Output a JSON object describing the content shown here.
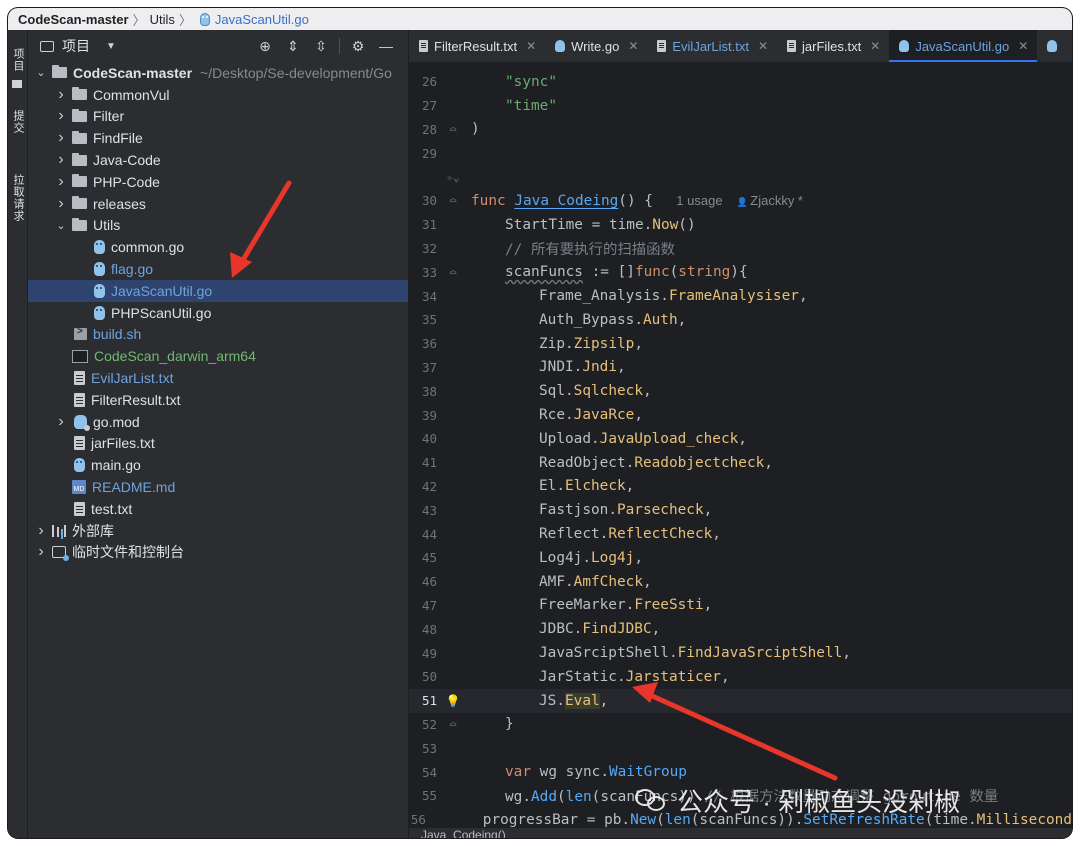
{
  "breadcrumb": {
    "project": "CodeScan-master",
    "folder": "Utils",
    "file": "JavaScanUtil.go"
  },
  "toolstrip": {
    "project_label": "项目",
    "commit_label": "提交",
    "pull_requests_label": "拉取请求"
  },
  "project_panel": {
    "title": "项目",
    "tree": [
      {
        "label": "CodeScan-master",
        "path_hint": "~/Desktop/Se-development/Go",
        "icon": "folder-icon",
        "arrow": "down",
        "indent": 0,
        "color": "normal",
        "root": true
      },
      {
        "label": "CommonVul",
        "icon": "folder-icon",
        "arrow": "right",
        "indent": 1,
        "color": "normal"
      },
      {
        "label": "Filter",
        "icon": "folder-icon",
        "arrow": "right",
        "indent": 1,
        "color": "normal"
      },
      {
        "label": "FindFile",
        "icon": "folder-icon",
        "arrow": "right",
        "indent": 1,
        "color": "normal"
      },
      {
        "label": "Java-Code",
        "icon": "folder-icon",
        "arrow": "right",
        "indent": 1,
        "color": "normal"
      },
      {
        "label": "PHP-Code",
        "icon": "folder-icon",
        "arrow": "right",
        "indent": 1,
        "color": "normal"
      },
      {
        "label": "releases",
        "icon": "folder-icon",
        "arrow": "right",
        "indent": 1,
        "color": "normal"
      },
      {
        "label": "Utils",
        "icon": "folder-icon",
        "arrow": "down",
        "indent": 1,
        "color": "normal"
      },
      {
        "label": "common.go",
        "icon": "go-file-icon",
        "arrow": "",
        "indent": 2,
        "color": "normal"
      },
      {
        "label": "flag.go",
        "icon": "go-file-icon",
        "arrow": "",
        "indent": 2,
        "color": "blue"
      },
      {
        "label": "JavaScanUtil.go",
        "icon": "go-file-icon",
        "arrow": "",
        "indent": 2,
        "color": "blue",
        "selected": true
      },
      {
        "label": "PHPScanUtil.go",
        "icon": "go-file-icon",
        "arrow": "",
        "indent": 2,
        "color": "normal"
      },
      {
        "label": "build.sh",
        "icon": "shell-script-icon",
        "arrow": "",
        "indent": 1,
        "color": "blue"
      },
      {
        "label": "CodeScan_darwin_arm64",
        "icon": "binary-file-icon",
        "arrow": "",
        "indent": 1,
        "color": "green"
      },
      {
        "label": "EvilJarList.txt",
        "icon": "text-file-icon",
        "arrow": "",
        "indent": 1,
        "color": "blue"
      },
      {
        "label": "FilterResult.txt",
        "icon": "text-file-icon",
        "arrow": "",
        "indent": 1,
        "color": "normal"
      },
      {
        "label": "go.mod",
        "icon": "go-mod-icon",
        "arrow": "right",
        "indent": 1,
        "color": "normal"
      },
      {
        "label": "jarFiles.txt",
        "icon": "text-file-icon",
        "arrow": "",
        "indent": 1,
        "color": "normal"
      },
      {
        "label": "main.go",
        "icon": "go-file-icon",
        "arrow": "",
        "indent": 1,
        "color": "normal"
      },
      {
        "label": "README.md",
        "icon": "markdown-file-icon",
        "arrow": "",
        "indent": 1,
        "color": "blue"
      },
      {
        "label": "test.txt",
        "icon": "text-file-icon",
        "arrow": "",
        "indent": 1,
        "color": "normal"
      },
      {
        "label": "外部库",
        "icon": "library-icon",
        "arrow": "right",
        "indent": 0,
        "color": "normal"
      },
      {
        "label": "临时文件和控制台",
        "icon": "scratches-icon",
        "arrow": "right",
        "indent": 0,
        "color": "normal"
      }
    ]
  },
  "tabs": [
    {
      "label": "FilterResult.txt",
      "icon": "text-file-icon",
      "active": false,
      "color": "normal"
    },
    {
      "label": "Write.go",
      "icon": "go-file-icon",
      "active": false,
      "color": "normal"
    },
    {
      "label": "EvilJarList.txt",
      "icon": "text-file-icon",
      "active": false,
      "color": "blue"
    },
    {
      "label": "jarFiles.txt",
      "icon": "text-file-icon",
      "active": false,
      "color": "normal"
    },
    {
      "label": "JavaScanUtil.go",
      "icon": "go-file-icon",
      "active": true,
      "color": "blue"
    }
  ],
  "editor": {
    "inlay_usage": "1 usage",
    "inlay_author": "Zjackky *",
    "lines": [
      {
        "n": "26",
        "indent": 1,
        "segs": [
          [
            "str",
            "\"sync\""
          ]
        ]
      },
      {
        "n": "27",
        "indent": 1,
        "segs": [
          [
            "str",
            "\"time\""
          ]
        ]
      },
      {
        "n": "28",
        "indent": 0,
        "segs": [
          [
            "plain",
            ")"
          ]
        ],
        "fold": true
      },
      {
        "n": "29",
        "indent": 0,
        "segs": []
      },
      {
        "n": "",
        "indent": 0,
        "segs": [],
        "ai_hint": true
      },
      {
        "n": "30",
        "indent": 0,
        "segs": [
          [
            "kw",
            "func "
          ],
          [
            "fn-ul",
            "Java_Codeing"
          ],
          [
            "plain",
            "() {  "
          ]
        ],
        "inlay": true,
        "fold": true
      },
      {
        "n": "31",
        "indent": 1,
        "segs": [
          [
            "plain",
            "StartTime = "
          ],
          [
            "plain",
            "time"
          ],
          [
            "plain",
            "."
          ],
          [
            "call",
            "Now"
          ],
          [
            "plain",
            "()"
          ]
        ]
      },
      {
        "n": "32",
        "indent": 1,
        "segs": [
          [
            "cmt",
            "// 所有要执行的扫描函数"
          ]
        ]
      },
      {
        "n": "33",
        "indent": 1,
        "segs": [
          [
            "plain-ul",
            "scanFuncs"
          ],
          [
            "plain",
            " := []"
          ],
          [
            "kw",
            "func"
          ],
          [
            "plain",
            "("
          ],
          [
            "kw",
            "string"
          ],
          [
            "plain",
            "){"
          ]
        ],
        "fold": true
      },
      {
        "n": "34",
        "indent": 2,
        "segs": [
          [
            "pkg",
            "Frame_Analysis"
          ],
          [
            "plain",
            "."
          ],
          [
            "mem",
            "FrameAnalysiser"
          ],
          [
            "plain",
            ","
          ]
        ]
      },
      {
        "n": "35",
        "indent": 2,
        "segs": [
          [
            "pkg",
            "Auth_Bypass"
          ],
          [
            "plain",
            "."
          ],
          [
            "mem",
            "Auth"
          ],
          [
            "plain",
            ","
          ]
        ]
      },
      {
        "n": "36",
        "indent": 2,
        "segs": [
          [
            "pkg",
            "Zip"
          ],
          [
            "plain",
            "."
          ],
          [
            "mem",
            "Zipsilp"
          ],
          [
            "plain",
            ","
          ]
        ]
      },
      {
        "n": "37",
        "indent": 2,
        "segs": [
          [
            "pkg",
            "JNDI"
          ],
          [
            "plain",
            "."
          ],
          [
            "mem",
            "Jndi"
          ],
          [
            "plain",
            ","
          ]
        ]
      },
      {
        "n": "38",
        "indent": 2,
        "segs": [
          [
            "pkg",
            "Sql"
          ],
          [
            "plain",
            "."
          ],
          [
            "mem",
            "Sqlcheck"
          ],
          [
            "plain",
            ","
          ]
        ]
      },
      {
        "n": "39",
        "indent": 2,
        "segs": [
          [
            "pkg",
            "Rce"
          ],
          [
            "plain",
            "."
          ],
          [
            "mem",
            "JavaRce"
          ],
          [
            "plain",
            ","
          ]
        ]
      },
      {
        "n": "40",
        "indent": 2,
        "segs": [
          [
            "pkg",
            "Upload"
          ],
          [
            "plain",
            "."
          ],
          [
            "mem",
            "JavaUpload_check"
          ],
          [
            "plain",
            ","
          ]
        ]
      },
      {
        "n": "41",
        "indent": 2,
        "segs": [
          [
            "pkg",
            "ReadObject"
          ],
          [
            "plain",
            "."
          ],
          [
            "mem",
            "Readobjectcheck"
          ],
          [
            "plain",
            ","
          ]
        ]
      },
      {
        "n": "42",
        "indent": 2,
        "segs": [
          [
            "pkg",
            "El"
          ],
          [
            "plain",
            "."
          ],
          [
            "mem",
            "Elcheck"
          ],
          [
            "plain",
            ","
          ]
        ]
      },
      {
        "n": "43",
        "indent": 2,
        "segs": [
          [
            "pkg",
            "Fastjson"
          ],
          [
            "plain",
            "."
          ],
          [
            "mem",
            "Parsecheck"
          ],
          [
            "plain",
            ","
          ]
        ]
      },
      {
        "n": "44",
        "indent": 2,
        "segs": [
          [
            "pkg",
            "Reflect"
          ],
          [
            "plain",
            "."
          ],
          [
            "mem",
            "ReflectCheck"
          ],
          [
            "plain",
            ","
          ]
        ]
      },
      {
        "n": "45",
        "indent": 2,
        "segs": [
          [
            "pkg",
            "Log4j"
          ],
          [
            "plain",
            "."
          ],
          [
            "mem",
            "Log4j"
          ],
          [
            "plain",
            ","
          ]
        ]
      },
      {
        "n": "46",
        "indent": 2,
        "segs": [
          [
            "pkg",
            "AMF"
          ],
          [
            "plain",
            "."
          ],
          [
            "mem",
            "AmfCheck"
          ],
          [
            "plain",
            ","
          ]
        ]
      },
      {
        "n": "47",
        "indent": 2,
        "segs": [
          [
            "pkg",
            "FreeMarker"
          ],
          [
            "plain",
            "."
          ],
          [
            "mem",
            "FreeSsti"
          ],
          [
            "plain",
            ","
          ]
        ]
      },
      {
        "n": "48",
        "indent": 2,
        "segs": [
          [
            "pkg",
            "JDBC"
          ],
          [
            "plain",
            "."
          ],
          [
            "mem",
            "FindJDBC"
          ],
          [
            "plain",
            ","
          ]
        ]
      },
      {
        "n": "49",
        "indent": 2,
        "segs": [
          [
            "pkg",
            "JavaSrciptShell"
          ],
          [
            "plain",
            "."
          ],
          [
            "mem",
            "FindJavaSrciptShell"
          ],
          [
            "plain",
            ","
          ]
        ]
      },
      {
        "n": "50",
        "indent": 2,
        "segs": [
          [
            "pkg",
            "JarStatic"
          ],
          [
            "plain",
            "."
          ],
          [
            "mem",
            "Jarstaticer"
          ],
          [
            "plain",
            ","
          ]
        ]
      },
      {
        "n": "51",
        "indent": 2,
        "segs": [
          [
            "pkg",
            "JS"
          ],
          [
            "plain",
            "."
          ],
          [
            "mem",
            "Eval"
          ],
          [
            "plain",
            ","
          ]
        ],
        "current": true,
        "bulb": true
      },
      {
        "n": "52",
        "indent": 1,
        "segs": [
          [
            "plain",
            "}"
          ]
        ],
        "fold": true
      },
      {
        "n": "53",
        "indent": 0,
        "segs": []
      },
      {
        "n": "54",
        "indent": 1,
        "segs": [
          [
            "kw",
            "var "
          ],
          [
            "plain",
            "wg "
          ],
          [
            "plain",
            "sync"
          ],
          [
            "plain",
            "."
          ],
          [
            "builtin",
            "WaitGroup"
          ]
        ]
      },
      {
        "n": "55",
        "indent": 1,
        "segs": [
          [
            "plain",
            "wg."
          ],
          [
            "call",
            "Add"
          ],
          [
            "plain",
            "("
          ],
          [
            "builtin",
            "len"
          ],
          [
            "plain",
            "(scanFuncs)) "
          ],
          [
            "cmt",
            "// 根据方法数量动态调整 goroutine 数量"
          ]
        ]
      },
      {
        "n": "56",
        "indent": 1,
        "segs": [
          [
            "plain",
            "progressBar = pb."
          ],
          [
            "call",
            "New"
          ],
          [
            "plain",
            "("
          ],
          [
            "builtin",
            "len"
          ],
          [
            "plain",
            "(scanFuncs))."
          ],
          [
            "call",
            "SetRefreshRate"
          ],
          [
            "plain",
            "(time."
          ],
          [
            "mem",
            "Millisecond"
          ]
        ]
      }
    ]
  },
  "statusbar": {
    "breadcrumb": "Java_Codeing()"
  },
  "watermark": {
    "text": "公众号 · 剁椒鱼头没剁椒"
  }
}
